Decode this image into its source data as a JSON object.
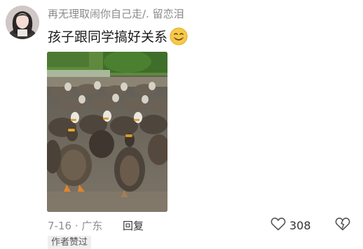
{
  "comment": {
    "username": "再无理取闹你自己走/. 留恋泪",
    "text": "孩子跟同学搞好关系",
    "emoji_icon": "smile-icon",
    "date": "7-16",
    "separator": "·",
    "location": "广东",
    "reply_label": "回复",
    "like_count": "308",
    "author_badge": "作者赞过"
  },
  "icons": {
    "like": "heart-icon",
    "dislike": "broken-heart-icon"
  },
  "colors": {
    "meta_gray": "#8f8f8f",
    "text_dark": "#1a1a1a",
    "badge_bg": "#efefef"
  }
}
